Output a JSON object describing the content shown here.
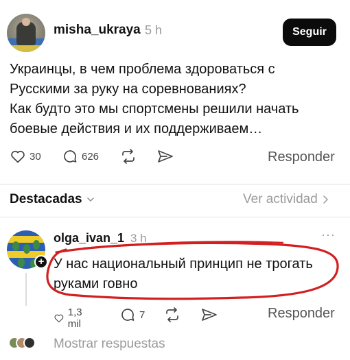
{
  "post": {
    "username": "misha_ukraya",
    "time": "5 h",
    "follow_label": "Seguir",
    "text_lines": [
      "Украинцы, в чем проблема здороваться с",
      "Русскими за руку на соревнованиях?",
      "Как будто это мы спортсмены решили начать",
      "боевые действия и их поддерживаем…"
    ],
    "likes": "30",
    "comments": "626",
    "reply_label": "Responder"
  },
  "featured": {
    "label": "Destacadas",
    "activity_label": "Ver actividad"
  },
  "comment": {
    "username": "olga_ivan_1",
    "time": "3 h",
    "more": "···",
    "text_lines": [
      "У нас национальный принцип не трогать",
      "руками говно"
    ],
    "likes": "1,3 mil",
    "comments": "7",
    "reply_label": "Responder",
    "show_replies_label": "Mostrar respuestas"
  },
  "colors": {
    "follow_bg": "#0b0b0b",
    "muted_text": "#9a9a9a",
    "scribble": "#d21f1f"
  },
  "icons": {
    "like": "heart-icon",
    "comment": "speech-bubble-icon",
    "repost": "repost-icon",
    "share": "send-icon",
    "chevron_down": "chevron-down-icon",
    "chevron_right": "chevron-right-icon",
    "more": "ellipsis-icon",
    "plus": "plus-icon"
  }
}
